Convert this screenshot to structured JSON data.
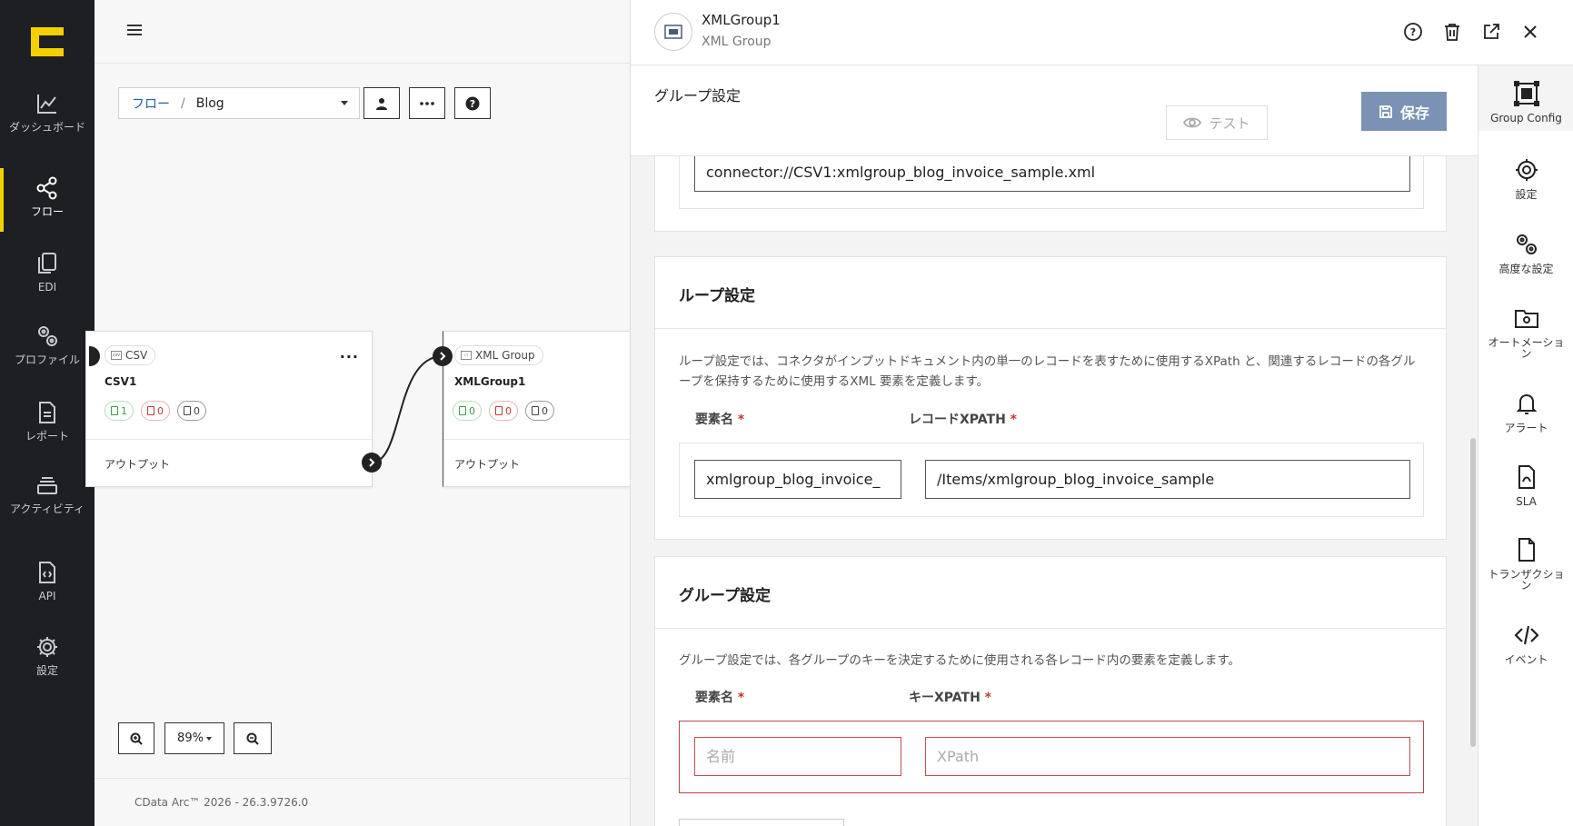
{
  "leftnav": {
    "items": [
      {
        "label": "ダッシュボード",
        "icon": "chart-line-icon"
      },
      {
        "label": "フロー",
        "icon": "share-nodes-icon"
      },
      {
        "label": "EDI",
        "icon": "documents-icon"
      },
      {
        "label": "プロファイル",
        "icon": "gears-icon"
      },
      {
        "label": "レポート",
        "icon": "report-icon"
      },
      {
        "label": "アクティビティ",
        "icon": "layers-icon"
      },
      {
        "label": "API",
        "icon": "api-doc-icon"
      },
      {
        "label": "設定",
        "icon": "gear-icon"
      }
    ],
    "active_index": 1,
    "accent": "#f5d000"
  },
  "canvas": {
    "breadcrumb": {
      "root": "フロー",
      "separator": "/",
      "current": "Blog"
    },
    "nodes": [
      {
        "type": "CSV",
        "name": "CSV1",
        "success": "1",
        "error": "0",
        "pending": "0",
        "output_label": "アウトプット"
      },
      {
        "type": "XML Group",
        "name": "XMLGroup1",
        "success": "0",
        "error": "0",
        "pending": "0",
        "output_label": "アウトプット"
      }
    ],
    "zoom": "89%",
    "footer": "CData Arc™ 2026 - 26.3.9726.0"
  },
  "panel": {
    "title": "XMLGroup1",
    "subtitle": "XML Group",
    "section_title": "グループ設定",
    "test_label": "テスト",
    "save_label": "保存",
    "save_color": "#7b92b4",
    "connector_path": "connector://CSV1:xmlgroup_blog_invoice_sample.xml",
    "loop": {
      "title": "ループ設定",
      "description": "ループ設定では、コネクタがインプットドキュメント内の単一のレコードを表すために使用するXPath と、関連するレコードの各グループを保持するために使用するXML 要素を定義します。",
      "element_label": "要素名",
      "xpath_label": "レコードXPATH",
      "element_value": "xmlgroup_blog_invoice_",
      "xpath_value": "/Items/xmlgroup_blog_invoice_sample"
    },
    "group": {
      "title": "グループ設定",
      "description": "グループ設定では、各グループのキーを決定するために使用される各レコード内の要素を定義します。",
      "element_label": "要素名",
      "xpath_label": "キーXPATH",
      "element_placeholder": "名前",
      "xpath_placeholder": "XPath"
    }
  },
  "rside": {
    "items": [
      {
        "label": "Group Config",
        "icon": "group-config-icon"
      },
      {
        "label": "設定",
        "icon": "gear-icon"
      },
      {
        "label": "高度な設定",
        "icon": "gears-icon"
      },
      {
        "label": "オートメーション",
        "icon": "folder-gear-icon"
      },
      {
        "label": "アラート",
        "icon": "bell-icon"
      },
      {
        "label": "SLA",
        "icon": "sla-doc-icon"
      },
      {
        "label": "トランザクション",
        "icon": "file-icon"
      },
      {
        "label": "イベント",
        "icon": "code-icon"
      }
    ],
    "active_index": 0
  }
}
